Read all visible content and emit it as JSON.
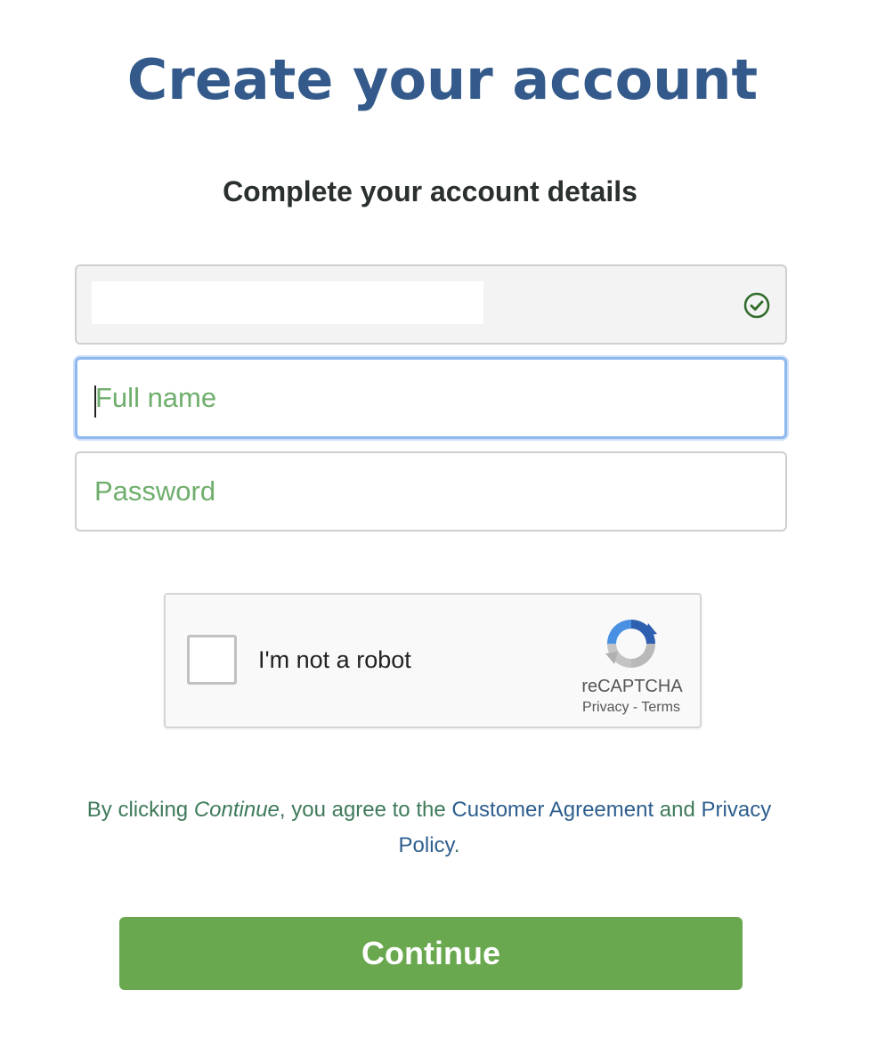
{
  "page": {
    "title": "Create your account",
    "subtitle": "Complete your account details"
  },
  "form": {
    "email": {
      "value": "",
      "status_icon": "check-circle-icon"
    },
    "full_name": {
      "value": "",
      "placeholder": "Full name"
    },
    "password": {
      "value": "",
      "placeholder": "Password"
    }
  },
  "recaptcha": {
    "label": "I'm not a robot",
    "brand": "reCAPTCHA",
    "privacy_link": "Privacy",
    "separator": " - ",
    "terms_link": "Terms",
    "icon": "recaptcha-logo-icon"
  },
  "terms": {
    "prefix": "By clicking ",
    "action_word": "Continue",
    "middle": ", you agree to the ",
    "customer_agreement_link": "Customer Agreement",
    "and": " and ",
    "privacy_policy_link": "Privacy Policy",
    "suffix": "."
  },
  "actions": {
    "continue_label": "Continue"
  },
  "colors": {
    "title": "#335a8b",
    "accent_green": "#6aa84f",
    "placeholder_green": "#6fae6c",
    "link_blue": "#2e5e8e",
    "focus_blue": "#8fb8ef"
  }
}
